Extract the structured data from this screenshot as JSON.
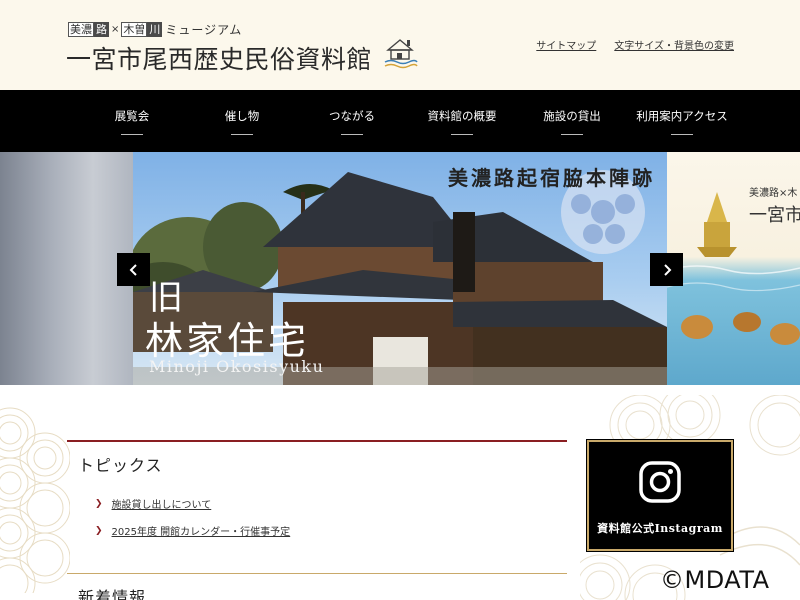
{
  "header": {
    "brand_sub": {
      "part1": "美濃",
      "part2": "路",
      "times": "×",
      "part3": "木曽",
      "part4": "川",
      "part5": "ミュージアム"
    },
    "title": "一宮市尾西歴史民俗資料館",
    "util_links": [
      "サイトマップ",
      "文字サイズ・背景色の変更"
    ]
  },
  "nav": {
    "items": [
      "展覧会",
      "催し物",
      "つながる",
      "資料館の概要",
      "施設の貸出",
      "利用案内アクセス"
    ]
  },
  "slider": {
    "main_title": "美濃路起宿脇本陣跡",
    "kanji_line1": "旧",
    "kanji_line2": "林家住宅",
    "roman": "Minoji Okosisyuku",
    "right_sub": "美濃路×木",
    "right_title": "一宮市",
    "prev_icon": "chevron-left-icon",
    "next_icon": "chevron-right-icon"
  },
  "topics": {
    "heading": "トピックス",
    "items": [
      "施設貸し出しについて",
      "2025年度 開館カレンダー・行催事予定"
    ]
  },
  "news": {
    "heading": "新着情報"
  },
  "instagram": {
    "label": "資料館公式Instagram",
    "icon": "instagram-icon"
  },
  "watermark": "©MDATA",
  "colors": {
    "nav_bg": "#000000",
    "accent": "#8a1e22",
    "gold": "#c9a96a",
    "header_bg": "#fcf8ec"
  }
}
